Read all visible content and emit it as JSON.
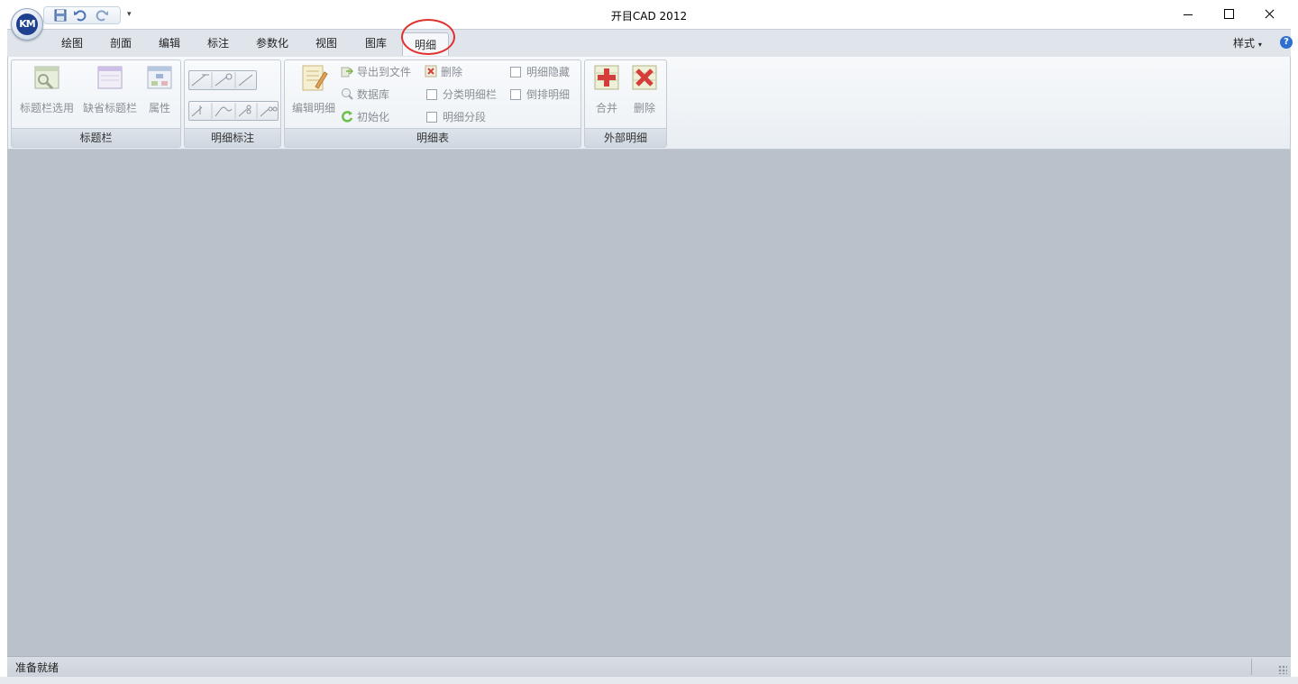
{
  "window": {
    "title": "开目CAD 2012"
  },
  "app_logo": {
    "text": "KM"
  },
  "tabs": [
    {
      "label": "绘图",
      "active": false
    },
    {
      "label": "剖面",
      "active": false
    },
    {
      "label": "编辑",
      "active": false
    },
    {
      "label": "标注",
      "active": false
    },
    {
      "label": "参数化",
      "active": false
    },
    {
      "label": "视图",
      "active": false
    },
    {
      "label": "图库",
      "active": false
    },
    {
      "label": "明细",
      "active": true
    }
  ],
  "style_menu": {
    "label": "样式"
  },
  "help": {
    "label": "?"
  },
  "ribbon": {
    "groups": {
      "title_bar": {
        "label": "标题栏",
        "buttons": [
          {
            "label": "标题栏选用",
            "icon": "title-select-icon"
          },
          {
            "label": "缺省标题栏",
            "icon": "default-title-icon"
          },
          {
            "label": "属性",
            "icon": "properties-icon"
          }
        ]
      },
      "detail_annotation": {
        "label": "明细标注"
      },
      "detail_table": {
        "label": "明细表",
        "edit_button": "编辑明细",
        "items": {
          "export": "导出到文件",
          "database": "数据库",
          "initialize": "初始化",
          "delete": "删除",
          "category_column": "分类明细栏",
          "segment": "明细分段",
          "hide": "明细隐藏",
          "reverse": "倒排明细"
        }
      },
      "external_detail": {
        "label": "外部明细",
        "buttons": [
          {
            "label": "合并",
            "icon": "merge-icon"
          },
          {
            "label": "删除",
            "icon": "delete-icon"
          }
        ]
      }
    }
  },
  "status_bar": {
    "text": "准备就绪"
  },
  "colors": {
    "workspace": "#bbc1cb",
    "highlight": "#e0322d",
    "disabled_text": "#8a8f96"
  }
}
